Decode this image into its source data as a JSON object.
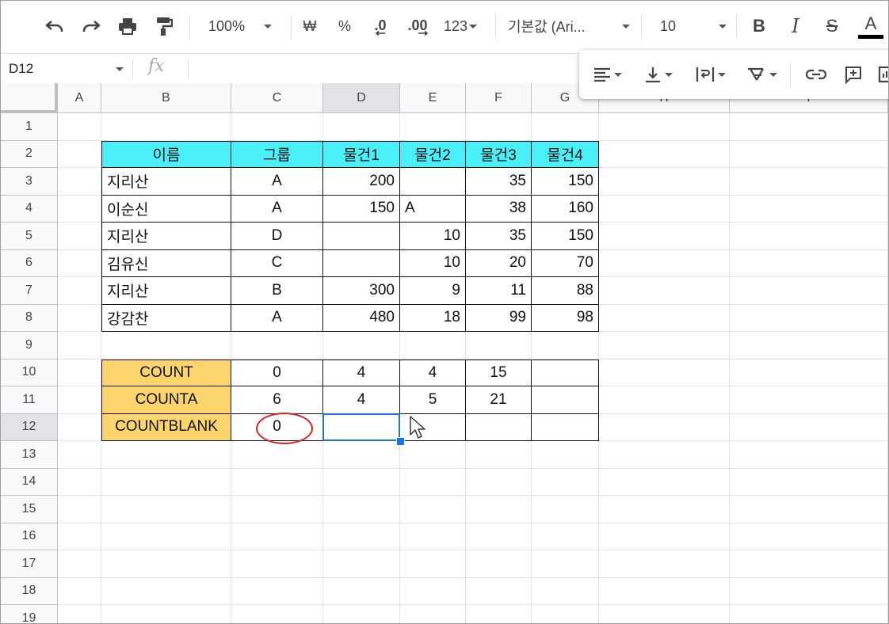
{
  "toolbar": {
    "zoom": "100%",
    "currency": "₩",
    "percent": "%",
    "decimal_decrease": ".0",
    "decimal_increase": ".00",
    "format_more": "123",
    "font_family": "기본값 (Ari...",
    "font_size": "10",
    "bold": "B",
    "italic": "I",
    "strike": "S",
    "text_color": "A"
  },
  "formula_bar": {
    "cell_ref": "D12",
    "fx": "fx",
    "value": ""
  },
  "columns": [
    "A",
    "B",
    "C",
    "D",
    "E",
    "F",
    "G",
    "H",
    "I"
  ],
  "rows": [
    "1",
    "2",
    "3",
    "4",
    "5",
    "6",
    "7",
    "8",
    "9",
    "10",
    "11",
    "12",
    "13",
    "14",
    "15",
    "16",
    "17",
    "18",
    "19"
  ],
  "table": {
    "headers": [
      "이름",
      "그룹",
      "물건1",
      "물건2",
      "물건3",
      "물건4"
    ],
    "rows": [
      [
        "지리산",
        "A",
        "200",
        "",
        "35",
        "150"
      ],
      [
        "이순신",
        "A",
        "150",
        "A",
        "38",
        "160"
      ],
      [
        "지리산",
        "D",
        "",
        "10",
        "35",
        "150"
      ],
      [
        "김유신",
        "C",
        "",
        "10",
        "20",
        "70"
      ],
      [
        "지리산",
        "B",
        "300",
        "9",
        "11",
        "88"
      ],
      [
        "강감찬",
        "A",
        "480",
        "18",
        "99",
        "98"
      ]
    ]
  },
  "summary": {
    "rows": [
      [
        "COUNT",
        "0",
        "4",
        "4",
        "15",
        ""
      ],
      [
        "COUNTA",
        "6",
        "4",
        "5",
        "21",
        ""
      ],
      [
        "COUNTBLANK",
        "0",
        "",
        "",
        "",
        ""
      ]
    ]
  },
  "colors": {
    "header_cyan": "#4af0f8",
    "label_yellow": "#fbd56b",
    "selection": "#1a73e8",
    "annotation": "#e02020"
  }
}
